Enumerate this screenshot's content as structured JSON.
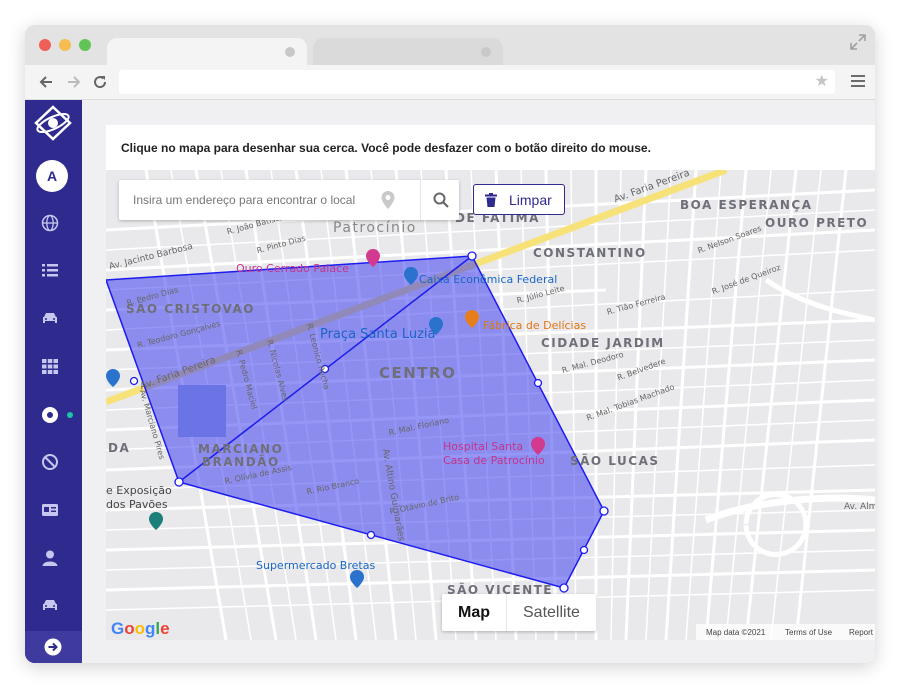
{
  "app": {
    "instruction": "Clique no mapa para desenhar sua cerca. Você pode desfazer com o botão direito do mouse.",
    "avatar_initial": "A"
  },
  "sidebar": {
    "items": [
      {
        "name": "globe-icon"
      },
      {
        "name": "list-icon"
      },
      {
        "name": "car-icon"
      },
      {
        "name": "grid-icon"
      },
      {
        "name": "record-icon",
        "status": "online"
      },
      {
        "name": "block-icon"
      },
      {
        "name": "id-card-icon"
      },
      {
        "name": "user-icon"
      },
      {
        "name": "car-icon"
      }
    ],
    "bottom_icon": "arrow-right-icon",
    "colors": {
      "background": "#2e2a8e",
      "status_dot": "#19c5a8"
    }
  },
  "search": {
    "placeholder": "Insira um endereço para encontrar o local"
  },
  "toolbar": {
    "clear_label": "Limpar"
  },
  "map_type": {
    "map_label": "Map",
    "satellite_label": "Satellite",
    "selected": "Map"
  },
  "map": {
    "google_logo": "Google",
    "attribution_data": "Map data ©2021",
    "attribution_terms": "Terms of Use",
    "attribution_report": "Report",
    "districts": {
      "sao_cristovao": "SÃO CRISTOVAO",
      "centro": "CENTRO",
      "marciano": "MARCIANO",
      "brandao": "BRANDÃO",
      "constantino": "CONSTANTINO",
      "boa_esperanca": "BOA ESPERANÇA",
      "ouro_preto": "OURO PRETO",
      "cidade_jardim": "CIDADE JARDIM",
      "sao_lucas": "SÃO LUCAS",
      "sao_vicente": "SÃO VICENTE",
      "de_fatima": "DE FÁTIMA",
      "patrocinio": "Patrocínio",
      "da": "DA"
    },
    "pois": {
      "ouro_cerrado": "Ouro Cerrado Palace",
      "caixa": "Caixa Econômica Federal",
      "praca": "Praça Santa Luzia",
      "fabrica": "Fábrica de Delícias",
      "hospital_1": "Hospital Santa",
      "hospital_2": "Casa de Patrocínio",
      "supermercado": "Supermercado Bretas",
      "exposicao_1": "e Exposição",
      "exposicao_2": "dos Pavões"
    },
    "streets": {
      "faria_pereira_top": "Av. Faria Pereira",
      "faria_pereira_left": "Av. Faria Pereira",
      "jacinto": "Av. Jacinto Barbosa",
      "altino": "Av. Altino Guimarães",
      "marciano_pires": "Av. Marciano Pires",
      "almir": "Av. Almir",
      "pinto_dias": "R. Pinto Dias",
      "joao_batista": "R. João Batista",
      "julio_leite": "R. Júlio Leite",
      "tiao_ferreira": "R. Tião Ferreira",
      "teodoro": "R. Teodoro Gonçalves",
      "pedro_dias": "R. Pedro Dias",
      "pedro_maciel": "R. Pedro Maciel",
      "nicolas": "R. Nicolas Alves",
      "leonico": "R. Leonico Rocha",
      "mal_floriano": "R. Mal. Floriano",
      "mal_deodoro": "R. Mal. Deodoro",
      "rio_branco": "R. Rio Branco",
      "olivia": "R. Olívia de Assis",
      "otavio": "R. Otávio de Brito",
      "tobias": "R. Mal. Tobias Machado",
      "belvedere": "R. Belvedere",
      "jose_queiroz": "R. José de Queiroz",
      "nelson_soares": "R. Nelson Soares"
    }
  }
}
